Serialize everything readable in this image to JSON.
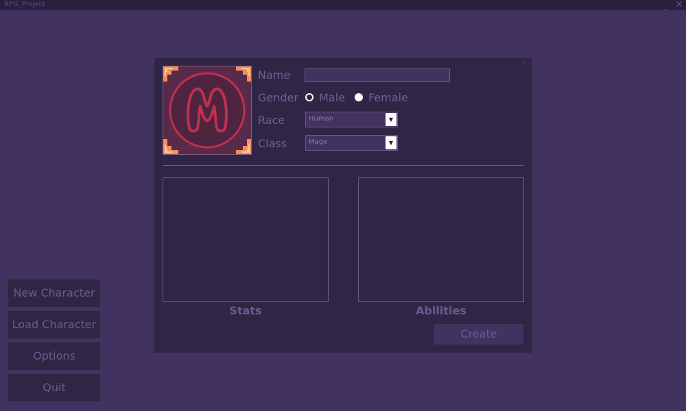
{
  "window": {
    "title": "RPG_Project",
    "minimize_glyph": "_",
    "close_glyph": "✕"
  },
  "main_menu": {
    "items": [
      {
        "label": "New Character"
      },
      {
        "label": "Load Character"
      },
      {
        "label": "Options"
      },
      {
        "label": "Quit"
      }
    ]
  },
  "character_panel": {
    "close_glyph": "✕",
    "portrait_icon": "mage-m-emblem-icon",
    "fields": {
      "name_label": "Name",
      "name_value": "",
      "gender_label": "Gender",
      "gender_options": [
        {
          "label": "Male",
          "selected": true
        },
        {
          "label": "Female",
          "selected": false
        }
      ],
      "race_label": "Race",
      "race_value": "Human",
      "class_label": "Class",
      "class_value": "Mage"
    },
    "stats_title": "Stats",
    "abilities_title": "Abilities",
    "create_label": "Create"
  },
  "colors": {
    "background": "#42325f",
    "panel": "#2f2645",
    "text_dim": "#6f5f96",
    "portrait_bg": "#5a2a4a",
    "portrait_emblem": "#c0304f",
    "portrait_corners": "#f0905a"
  }
}
